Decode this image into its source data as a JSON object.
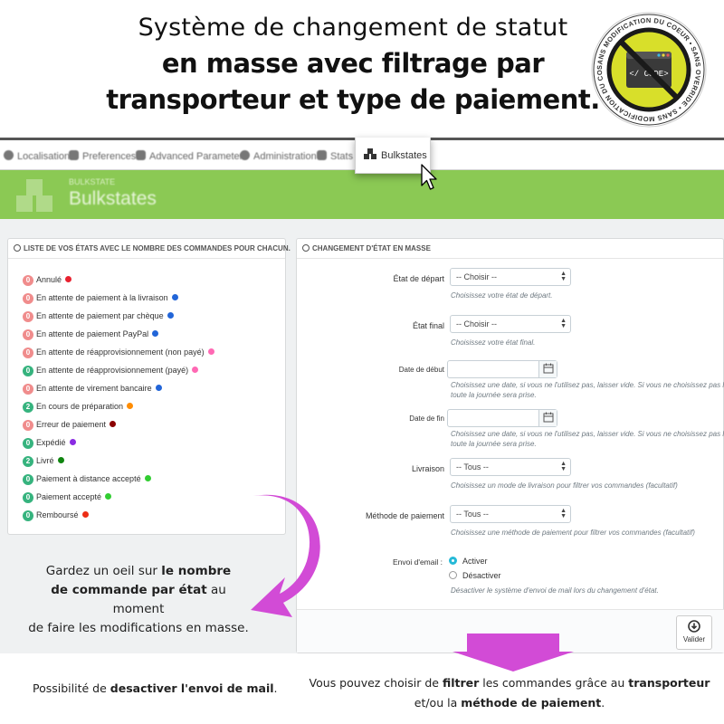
{
  "headline": {
    "line1": "Système de changement de statut",
    "line2": "en masse avec filtrage par",
    "line3": "transporteur et type de paiement."
  },
  "badge": {
    "ring_text": "SANS MODIFICATION DU COEUR • SANS OVERRIDE • SANS MODIFICATION DU COEUR",
    "code_label": "</ CODE>"
  },
  "nav": {
    "items": [
      {
        "label": "Localisation",
        "icon": "globe-icon"
      },
      {
        "label": "Preferences",
        "icon": "wrench-icon"
      },
      {
        "label": "Advanced Parameters",
        "icon": "cogs-icon"
      },
      {
        "label": "Administration",
        "icon": "cog-icon"
      },
      {
        "label": "Stats",
        "icon": "chart-icon"
      }
    ],
    "active": {
      "label": "Bulkstates",
      "icon": "cubes-icon"
    }
  },
  "toolbar": {
    "breadcrumb": "BULKSTATE",
    "title": "Bulkstates"
  },
  "left_panel": {
    "heading": "LISTE DE VOS ÉTATS AVEC LE NOMBRE DES COMMANDES POUR CHACUN.",
    "statuses": [
      {
        "count": "0",
        "label": "Annulé",
        "dot": "#e8212f",
        "badge": "#f08c8c"
      },
      {
        "count": "0",
        "label": "En attente de paiement à la livraison",
        "dot": "#2265d8",
        "badge": "#f08c8c"
      },
      {
        "count": "0",
        "label": "En attente de paiement par chèque",
        "dot": "#2265d8",
        "badge": "#f08c8c"
      },
      {
        "count": "0",
        "label": "En attente de paiement PayPal",
        "dot": "#2265d8",
        "badge": "#f08c8c"
      },
      {
        "count": "0",
        "label": "En attente de réapprovisionnement (non payé)",
        "dot": "#ff69b4",
        "badge": "#f08c8c"
      },
      {
        "count": "0",
        "label": "En attente de réapprovisionnement (payé)",
        "dot": "#ff69b4",
        "badge": "#36b37e"
      },
      {
        "count": "0",
        "label": "En attente de virement bancaire",
        "dot": "#2265d8",
        "badge": "#f08c8c"
      },
      {
        "count": "2",
        "label": "En cours de préparation",
        "dot": "#ff8c00",
        "badge": "#36b37e"
      },
      {
        "count": "0",
        "label": "Erreur de paiement",
        "dot": "#8b0000",
        "badge": "#f08c8c"
      },
      {
        "count": "0",
        "label": "Expédié",
        "dot": "#8a2be2",
        "badge": "#36b37e"
      },
      {
        "count": "2",
        "label": "Livré",
        "dot": "#108510",
        "badge": "#36b37e"
      },
      {
        "count": "0",
        "label": "Paiement à distance accepté",
        "dot": "#32cd32",
        "badge": "#36b37e"
      },
      {
        "count": "0",
        "label": "Paiement accepté",
        "dot": "#32cd32",
        "badge": "#36b37e"
      },
      {
        "count": "0",
        "label": "Remboursé",
        "dot": "#ec2e15",
        "badge": "#36b37e"
      }
    ]
  },
  "right_panel": {
    "heading": "CHANGEMENT D'ÉTAT EN MASSE",
    "etat_depart": {
      "label": "État de départ",
      "value": "-- Choisir --",
      "help": "Choisissez votre état de départ."
    },
    "etat_final": {
      "label": "État final",
      "value": "-- Choisir --",
      "help": "Choisissez votre état final."
    },
    "date_debut": {
      "label": "Date de début",
      "value": "",
      "help1": "Choisissez une date, si vous ne l'utilisez pas, laisser vide. Si vous ne choisissez pas l'heure (co",
      "help2": "toute la journée sera prise."
    },
    "date_fin": {
      "label": "Date de fin",
      "value": "",
      "help1": "Choisissez une date, si vous ne l'utilisez pas, laisser vide. Si vous ne choisissez pas l'heure (co",
      "help2": "toute la journée sera prise."
    },
    "livraison": {
      "label": "Livraison",
      "value": "-- Tous --",
      "help": "Choisissez un mode de livraison pour filtrer vos commandes (facultatif)"
    },
    "paiement": {
      "label": "Méthode de paiement",
      "value": "-- Tous --",
      "help": "Choisissez une méthode de paiement pour filtrer vos commandes (facultatif)"
    },
    "envoi_email": {
      "label": "Envoi d'email :",
      "option_on": "Activer",
      "option_off": "Désactiver",
      "selected": "Activer",
      "help": "Désactiver le système d'envoi de mail lors du changement d'état."
    },
    "save_label": "Valider"
  },
  "callouts": {
    "left_plain1": "Gardez un oeil sur ",
    "left_bold1": "le nombre",
    "left_bold2": "de commande par état",
    "left_plain2": " au moment",
    "left_plain3": "de faire les modifications en masse.",
    "bottom_left_plain": "Possibilité de ",
    "bottom_left_bold": "desactiver l'envoi de mail",
    "bottom_left_end": ".",
    "bottom_right_plain1": "Vous pouvez choisir de ",
    "bottom_right_bold1": "filtrer",
    "bottom_right_plain2": " les commandes grâce au ",
    "bottom_right_bold2": "transporteur",
    "bottom_right_plain3": "et/ou la ",
    "bottom_right_bold3": "méthode de paiement",
    "bottom_right_end": "."
  },
  "colors": {
    "accent_green": "#8bc954",
    "arrow_magenta": "#d24bd6",
    "radio_blue": "#25b9d7",
    "badge_yellow": "#d8df2a"
  }
}
